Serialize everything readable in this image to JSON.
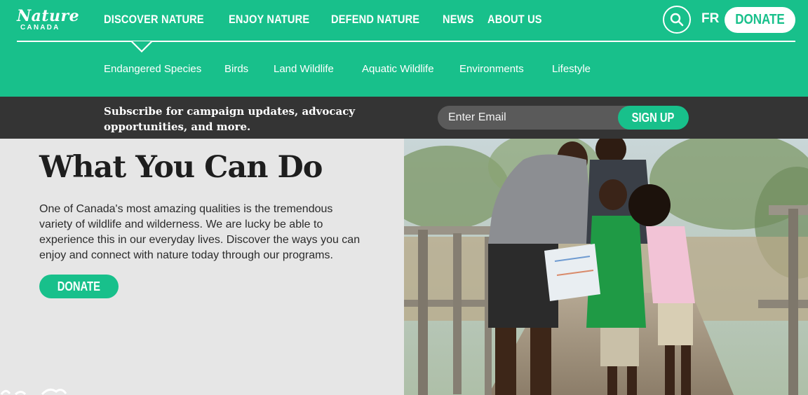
{
  "logo": {
    "script": "Nature",
    "subtitle": "CANADA"
  },
  "main_nav": [
    "DISCOVER NATURE",
    "ENJOY NATURE",
    "DEFEND NATURE",
    "NEWS",
    "ABOUT US"
  ],
  "lang": "FR",
  "donate_top": "DONATE",
  "sub_nav": [
    "Endangered Species",
    "Birds",
    "Land Wildlife",
    "Aquatic Wildlife",
    "Environments",
    "Lifestyle"
  ],
  "subscribe": {
    "text": "Subscribe for campaign updates, advocacy opportunities, and more.",
    "email_placeholder": "Enter Email",
    "button": "SIGN UP"
  },
  "content": {
    "heading": "What You Can Do",
    "body": "One of Canada's most amazing qualities is the tremendous variety of wildlife and wilderness. We are lucky be able to experience this in our everyday lives. Discover the ways you can enjoy and connect with nature today through our programs.",
    "donate": "DONATE"
  },
  "colors": {
    "brand_green": "#18c08b",
    "dark_bar": "#343434",
    "content_bg": "#e6e6e6"
  },
  "icons": [
    "search-icon"
  ]
}
